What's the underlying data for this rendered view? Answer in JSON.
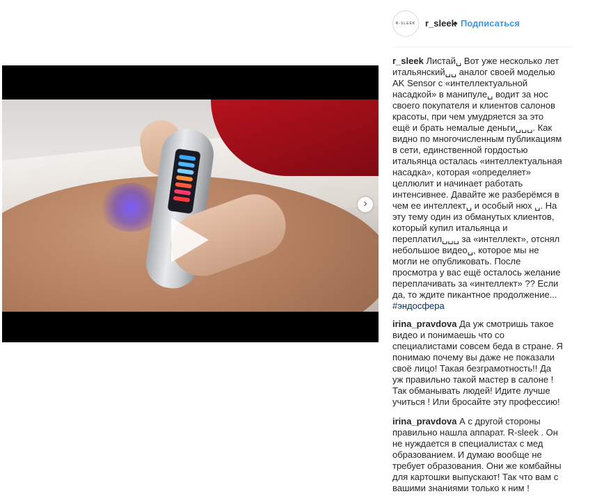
{
  "header": {
    "avatar_text": "R-SLEEK",
    "username": "r_sleek",
    "separator": "•",
    "follow_label": "Подписаться"
  },
  "media": {
    "next_icon": "chevron-right-icon",
    "page_dots": 2,
    "active_dot": 1
  },
  "caption": {
    "username": "r_sleek",
    "text": "Листай␣ Вот уже несколько лет итальянский␣␣ аналог своей моделью AK Sensor с «интеллектуальной насадкой» в манипуле␣ водит за нос своего покупателя и клиентов салонов красоты, при чем умудряется за это ещё и брать немалые деньги␣␣␣. Как видно по многочисленным публикациям в сети, единственной гордостью итальянца осталась «интеллектуальная насадка», которая «определяет» целлюлит и начинает работать интенсивнее. Давайте же разберёмся в чем ее интеллект␣ и особый нюх ␣. На эту тему один из обманутых клиентов, который купил итальянца и переплатил␣␣␣ за «интеллект», отснял небольшое видео␣, которое мы не могли не опубликовать. После просмотра у вас ещё осталось желание переплачивать за «интеллект» ?? Если да, то ждите пикантное продолжение...",
    "hashtag": "#эндосфера"
  },
  "comments": [
    {
      "username": "irina_pravdova",
      "text": "Да уж смотришь такое видео и понимаешь что со специалистами совсем беда в стране. Я понимаю почему вы даже не показали своё лицо! Такая безграмотность!! Да уж правильно такой мастер в салоне ! Так обманывать людей! Идите лучше учиться ! Или бросайте эту профессию!"
    },
    {
      "username": "irina_pravdova",
      "text": "А с другой стороны правильно нашла аппарат. R-sleek . Он не нуждается в специалистах с мед образованием. И думаю вообще не требует образования. Они же комбайны для картошки выпускают! Так что вам с вашими знаниями только к ним !"
    }
  ]
}
